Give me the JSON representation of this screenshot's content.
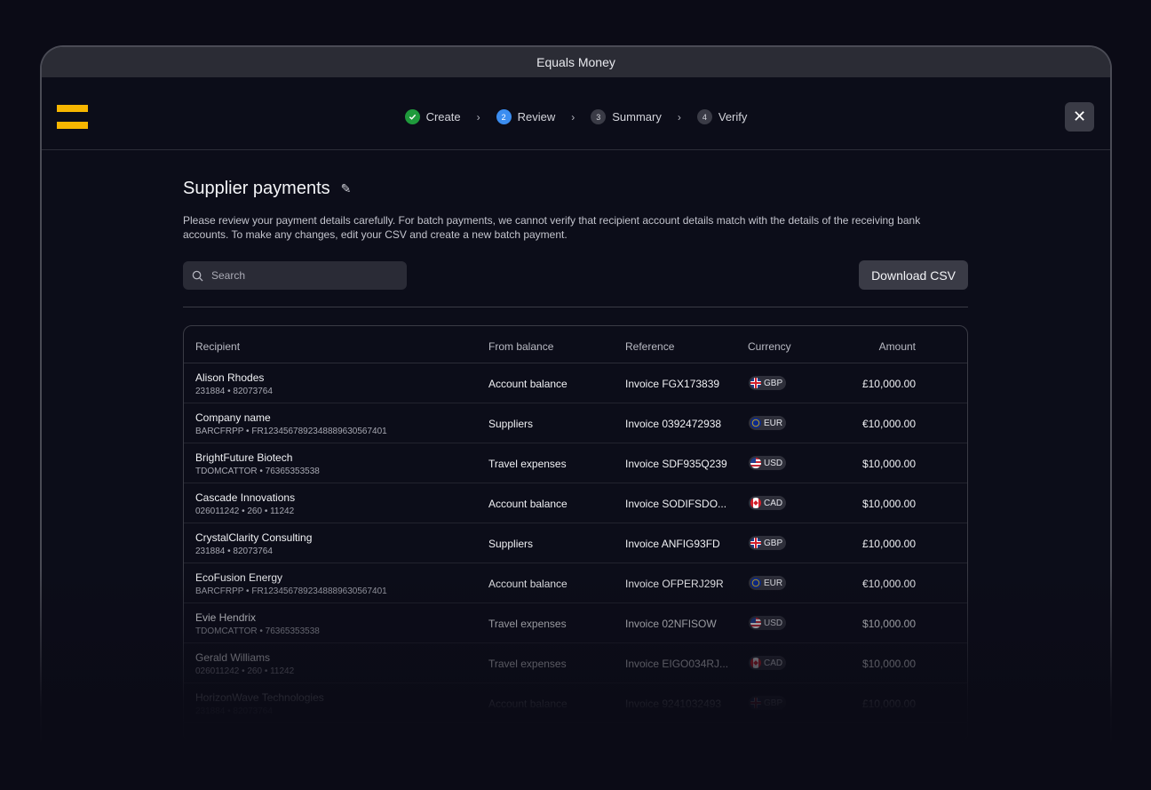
{
  "window": {
    "title": "Equals Money"
  },
  "stepper": [
    {
      "num": "✓",
      "label": "Create",
      "state": "done"
    },
    {
      "num": "2",
      "label": "Review",
      "state": "active"
    },
    {
      "num": "3",
      "label": "Summary",
      "state": "pending"
    },
    {
      "num": "4",
      "label": "Verify",
      "state": "pending"
    }
  ],
  "page": {
    "title": "Supplier payments",
    "description": "Please review your payment details carefully. For batch payments, we cannot verify that recipient account details match with the details of the receiving bank accounts. To make any changes, edit your CSV and create a new batch payment."
  },
  "search": {
    "placeholder": "Search"
  },
  "toolbar": {
    "download_label": "Download CSV"
  },
  "table": {
    "headers": {
      "recipient": "Recipient",
      "from_balance": "From balance",
      "reference": "Reference",
      "currency": "Currency",
      "amount": "Amount"
    },
    "rows": [
      {
        "name": "Alison Rhodes",
        "account": "231884 • 82073764",
        "balance": "Account balance",
        "reference": "Invoice FGX173839",
        "currency": "GBP",
        "amount": "£10,000.00"
      },
      {
        "name": "Company name",
        "account": "BARCFRPP • FR1234567892348889630567401",
        "balance": "Suppliers",
        "reference": "Invoice 0392472938",
        "currency": "EUR",
        "amount": "€10,000.00"
      },
      {
        "name": "BrightFuture Biotech",
        "account": "TDOMCATTOR • 76365353538",
        "balance": "Travel expenses",
        "reference": "Invoice SDF935Q239",
        "currency": "USD",
        "amount": "$10,000.00"
      },
      {
        "name": "Cascade Innovations",
        "account": "026011242 • 260 • 11242",
        "balance": "Account balance",
        "reference": "Invoice SODIFSDO...",
        "currency": "CAD",
        "amount": "$10,000.00"
      },
      {
        "name": "CrystalClarity Consulting",
        "account": "231884 • 82073764",
        "balance": "Suppliers",
        "reference": "Invoice ANFIG93FD",
        "currency": "GBP",
        "amount": "£10,000.00"
      },
      {
        "name": "EcoFusion Energy",
        "account": "BARCFRPP • FR1234567892348889630567401",
        "balance": "Account balance",
        "reference": "Invoice OFPERJ29R",
        "currency": "EUR",
        "amount": "€10,000.00"
      },
      {
        "name": "Evie Hendrix",
        "account": "TDOMCATTOR • 76365353538",
        "balance": "Travel expenses",
        "reference": "Invoice 02NFISOW",
        "currency": "USD",
        "amount": "$10,000.00"
      },
      {
        "name": "Gerald Williams",
        "account": "026011242 • 260 • 11242",
        "balance": "Travel expenses",
        "reference": "Invoice EIGO034RJ...",
        "currency": "CAD",
        "amount": "$10,000.00"
      },
      {
        "name": "HorizonWave Technologies",
        "account": "231884 • 82073764",
        "balance": "Account balance",
        "reference": "Invoice 9241032493",
        "currency": "GBP",
        "amount": "£10,000.00"
      }
    ]
  },
  "colors": {
    "brand": "#f7b600",
    "step_done": "#1f9a3c",
    "step_active": "#3b8df0",
    "background": "#0b0b16"
  }
}
